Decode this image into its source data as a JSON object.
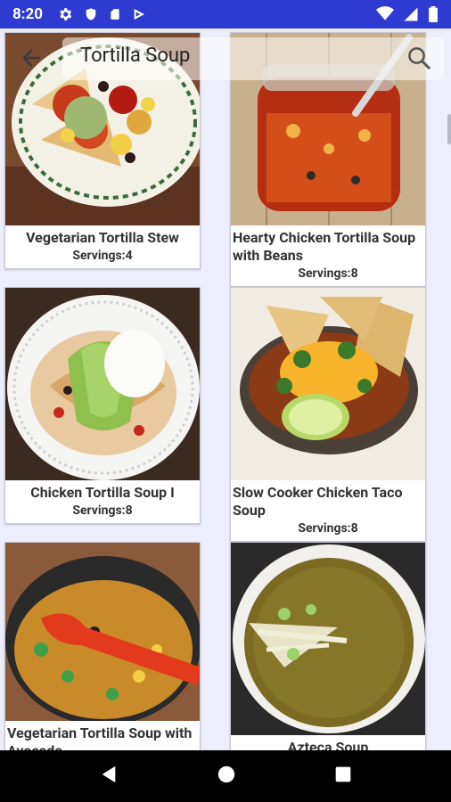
{
  "status_bar": {
    "time": "8:20",
    "icons_left": [
      "gear-icon",
      "shield-icon",
      "sdcard-icon",
      "play-icon"
    ],
    "icons_right": [
      "wifi-icon",
      "signal-icon",
      "battery-icon"
    ]
  },
  "toolbar": {
    "search_value": "Tortilla Soup"
  },
  "recipes": [
    {
      "title": "Vegetarian Tortilla Stew",
      "servings": "Servings:4"
    },
    {
      "title": "Hearty Chicken Tortilla Soup with Beans",
      "servings": "Servings:8"
    },
    {
      "title": "Chicken Tortilla Soup I",
      "servings": "Servings:8"
    },
    {
      "title": "Slow Cooker Chicken Taco Soup",
      "servings": "Servings:8"
    },
    {
      "title": "Vegetarian Tortilla Soup with Avocado",
      "servings": ""
    },
    {
      "title": "Azteca Soup",
      "servings": ""
    }
  ],
  "colors": {
    "status_bar": "#2d3bd0",
    "background": "#eceefb",
    "nav_bar": "#000000"
  }
}
